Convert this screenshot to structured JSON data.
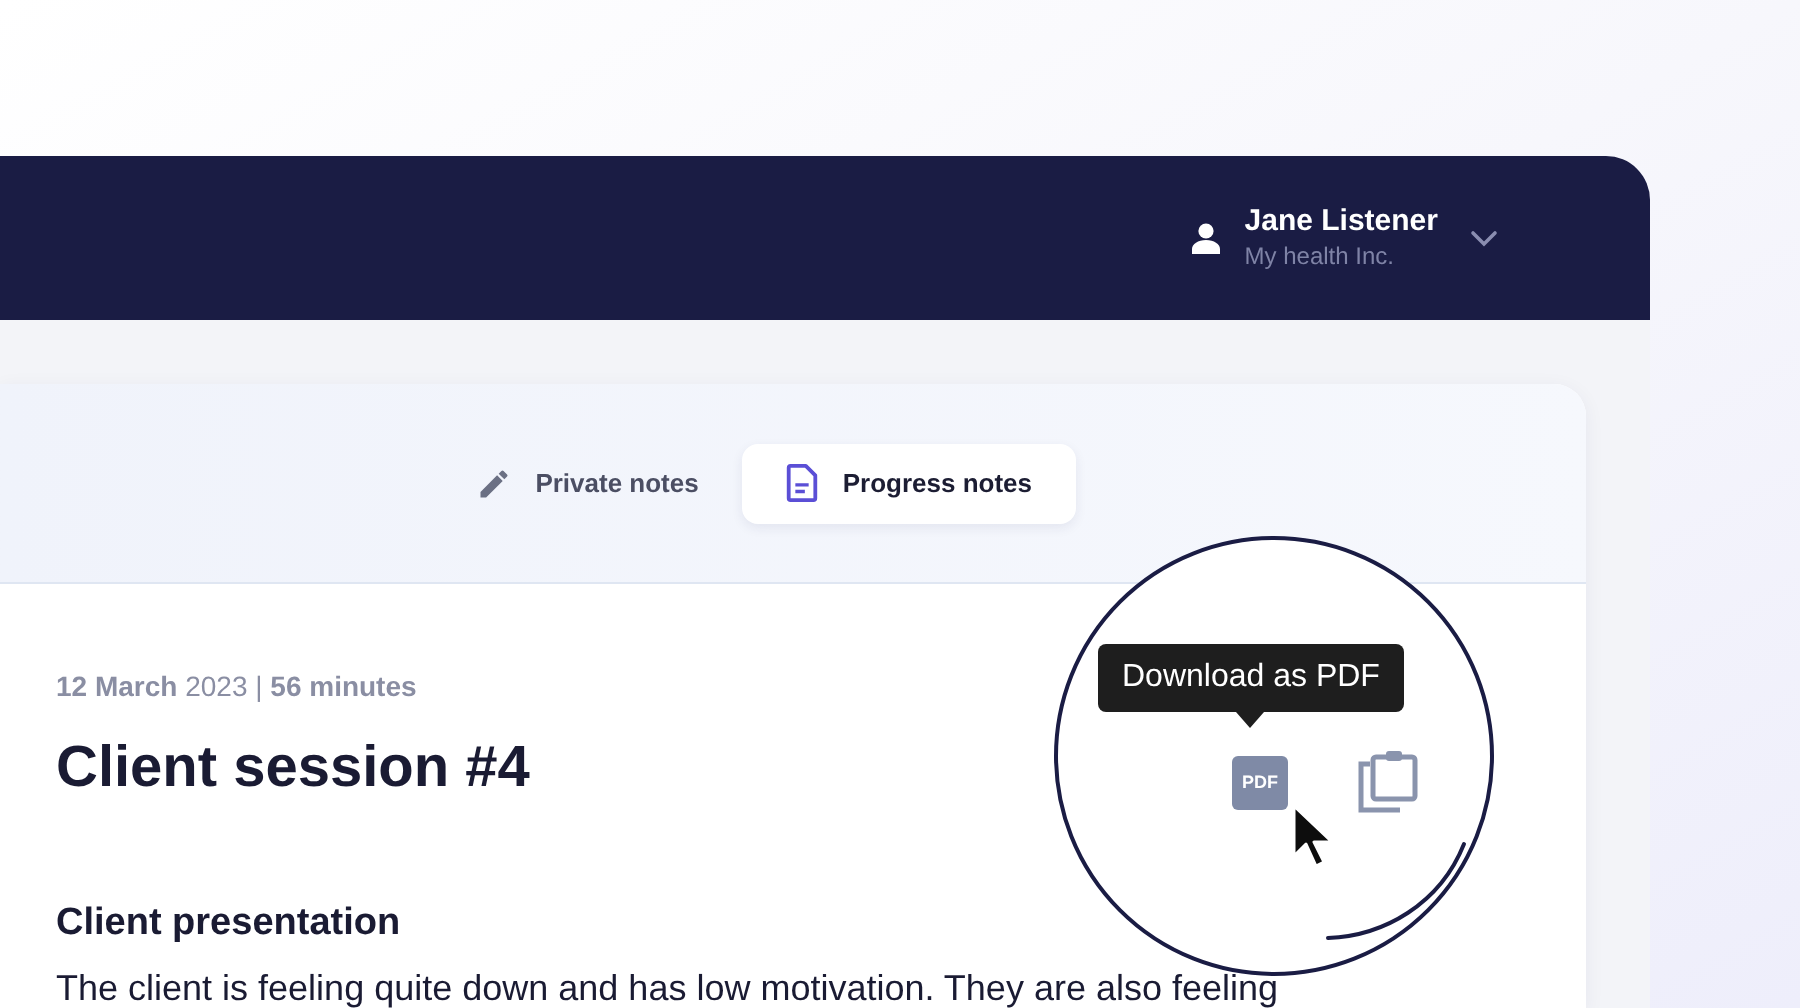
{
  "user": {
    "name": "Jane Listener",
    "organization": "My health Inc."
  },
  "tabs": [
    {
      "label": "Private notes",
      "kind": "pencil",
      "selected": false
    },
    {
      "label": "Progress notes",
      "kind": "document",
      "selected": true
    }
  ],
  "session": {
    "meta": "**12 March** 2023 | **56 minutes**",
    "title": "Client session #4"
  },
  "sections": [
    {
      "heading": "Client presentation",
      "text": "The client is feeling quite down and has low motivation. They are also feeling"
    }
  ],
  "magnifier": {
    "tooltip": "Download as PDF",
    "pdf_label": "PDF"
  }
}
